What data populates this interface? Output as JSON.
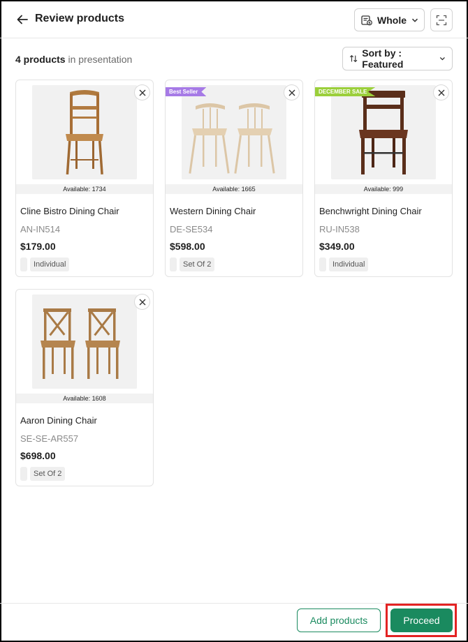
{
  "header": {
    "title": "Review products",
    "price_type_label": "Whole..."
  },
  "summary": {
    "count_bold": "4 products",
    "count_rest": "in presentation"
  },
  "sort": {
    "label": "Sort by : Featured"
  },
  "products": [
    {
      "name": "Cline Bistro Dining Chair",
      "sku": "AN-IN514",
      "price": "$179.00",
      "availability": "Available: 1734",
      "tag": "Individual",
      "ribbon": "",
      "ribbon_color": ""
    },
    {
      "name": "Western Dining Chair",
      "sku": "DE-SE534",
      "price": "$598.00",
      "availability": "Available: 1665",
      "tag": "Set Of 2",
      "ribbon": "Best Seller",
      "ribbon_color": "#a67ae6"
    },
    {
      "name": "Benchwright Dining Chair",
      "sku": "RU-IN538",
      "price": "$349.00",
      "availability": "Available: 999",
      "tag": "Individual",
      "ribbon": "DECEMBER SALE",
      "ribbon_color": "#9bcf3b"
    },
    {
      "name": "Aaron Dining Chair",
      "sku": "SE-SE-AR557",
      "price": "$698.00",
      "availability": "Available: 1608",
      "tag": "Set Of 2",
      "ribbon": "",
      "ribbon_color": ""
    }
  ],
  "footer": {
    "add_label": "Add products",
    "proceed_label": "Proceed"
  },
  "colors": {
    "accent": "#1a8a5f",
    "highlight": "#e32323"
  }
}
